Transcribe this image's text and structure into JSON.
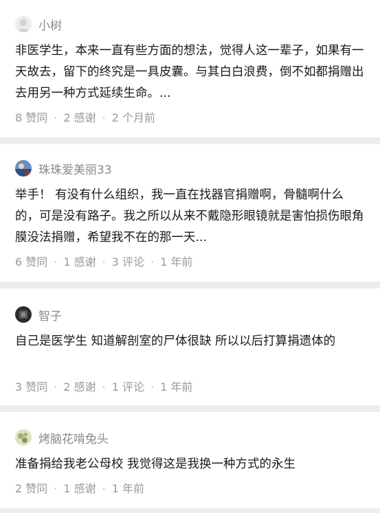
{
  "answers": [
    {
      "author": "小树",
      "avatar_color": "#e6e6e6",
      "text": "非医学生，本来一直有些方面的想法，觉得人这一辈子，如果有一天故去，留下的终究是一具皮囊。与其白白浪费，倒不如都捐赠出去用另一种方式延续生命。...",
      "meta": [
        "8 赞同",
        "2 感谢",
        "2 个月前"
      ]
    },
    {
      "author": "珠珠爱美丽33",
      "avatar_color": "#3a6fb0",
      "text": "举手！ 有没有什么组织，我一直在找器官捐赠啊，骨髓啊什么的，可是没有路子。我之所以从来不戴隐形眼镜就是害怕损伤眼角膜没法捐赠，希望我不在的那一天...",
      "meta": [
        "6 赞同",
        "1 感谢",
        "3 评论",
        "1 年前"
      ]
    },
    {
      "author": "智子",
      "avatar_color": "#3c3c3c",
      "text": "自己是医学生 知道解剖室的尸体很缺 所以以后打算捐遗体的",
      "meta": [
        "3 赞同",
        "2 感谢",
        "1 评论",
        "1 年前"
      ]
    },
    {
      "author": "烤脑花啃兔头",
      "avatar_color": "#c9cf9a",
      "text": "准备捐给我老公母校 我觉得这是我换一种方式的永生",
      "meta": [
        "2 赞同",
        "1 感谢",
        "1 年前"
      ]
    }
  ]
}
